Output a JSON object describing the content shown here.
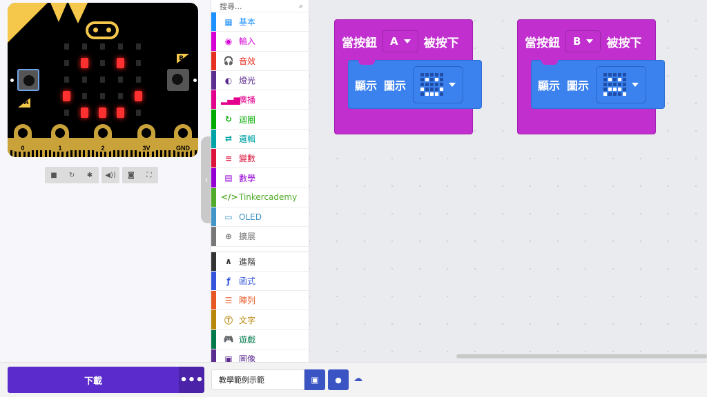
{
  "simulator": {
    "board": {
      "button_a_label": "A",
      "button_b_label": "B",
      "pins": [
        "0",
        "1",
        "2",
        "3V",
        "GND"
      ],
      "leds": [
        [
          0,
          0,
          0,
          0,
          0
        ],
        [
          0,
          1,
          0,
          1,
          0
        ],
        [
          0,
          0,
          0,
          0,
          0
        ],
        [
          1,
          0,
          0,
          0,
          1
        ],
        [
          0,
          1,
          1,
          1,
          0
        ]
      ]
    },
    "controls": [
      "stop-icon",
      "restart-icon",
      "debug-icon",
      "mute-icon",
      "screenshot-icon",
      "fullscreen-icon"
    ]
  },
  "toolbox": {
    "search_placeholder": "搜尋...",
    "categories": [
      {
        "label": "基本",
        "color": "#1e90ff",
        "icon": "grid-icon",
        "glyph": "▦"
      },
      {
        "label": "輸入",
        "color": "#d400d4",
        "icon": "target-icon",
        "glyph": "◉"
      },
      {
        "label": "音效",
        "color": "#e63022",
        "icon": "headphones-icon",
        "glyph": "🎧"
      },
      {
        "label": "燈光",
        "color": "#5c2d91",
        "icon": "toggle-icon",
        "glyph": "◐"
      },
      {
        "label": "廣播",
        "color": "#e3008c",
        "icon": "signal-icon",
        "glyph": "▂▄▆"
      },
      {
        "label": "迴圈",
        "color": "#00aa00",
        "icon": "loop-icon",
        "glyph": "↻"
      },
      {
        "label": "邏輯",
        "color": "#00a4a6",
        "icon": "shuffle-icon",
        "glyph": "⇄"
      },
      {
        "label": "變數",
        "color": "#dc143c",
        "icon": "list-icon",
        "glyph": "≡"
      },
      {
        "label": "數學",
        "color": "#9400d3",
        "icon": "calculator-icon",
        "glyph": "▤"
      },
      {
        "label": "Tinkercademy",
        "color": "#4fab29",
        "icon": "code-icon",
        "glyph": "</>"
      },
      {
        "label": "OLED",
        "color": "#4096c7",
        "icon": "monitor-icon",
        "glyph": "▭"
      },
      {
        "label": "擴展",
        "color": "#777777",
        "icon": "plus-circle-icon",
        "glyph": "⊕"
      }
    ],
    "advanced": [
      {
        "label": "進階",
        "color": "#333333",
        "icon": "chevron-up-icon",
        "glyph": "∧"
      },
      {
        "label": "函式",
        "color": "#3455db",
        "icon": "function-icon",
        "glyph": "ƒ"
      },
      {
        "label": "陣列",
        "color": "#e65722",
        "icon": "array-icon",
        "glyph": "☰"
      },
      {
        "label": "文字",
        "color": "#b8860b",
        "icon": "text-icon",
        "glyph": "Ⓣ"
      },
      {
        "label": "遊戲",
        "color": "#007a4b",
        "icon": "gamepad-icon",
        "glyph": "🎮"
      },
      {
        "label": "圖像",
        "color": "#5c2d91",
        "icon": "image-icon",
        "glyph": "▣"
      }
    ]
  },
  "workspace": {
    "blocks": [
      {
        "event_prefix": "當按鈕",
        "button": "A",
        "event_suffix": "被按下",
        "show_label": "顯示",
        "image_label": "圖示",
        "image": [
          [
            0,
            0,
            0,
            0,
            0
          ],
          [
            0,
            1,
            0,
            1,
            0
          ],
          [
            0,
            0,
            0,
            0,
            0
          ],
          [
            1,
            0,
            0,
            0,
            1
          ],
          [
            0,
            1,
            1,
            1,
            0
          ]
        ]
      },
      {
        "event_prefix": "當按鈕",
        "button": "B",
        "event_suffix": "被按下",
        "show_label": "顯示",
        "image_label": "圖示",
        "image": [
          [
            0,
            0,
            0,
            0,
            0
          ],
          [
            0,
            1,
            0,
            1,
            0
          ],
          [
            0,
            0,
            0,
            0,
            0
          ],
          [
            0,
            1,
            1,
            1,
            0
          ],
          [
            1,
            0,
            0,
            0,
            1
          ]
        ]
      }
    ]
  },
  "bottom_bar": {
    "download_label": "下載",
    "more_label": "•••",
    "project_name": "教學範例示範"
  },
  "colors": {
    "event_block": "#c22fcf",
    "basic_block": "#3c82ee",
    "download": "#5b2ccb"
  }
}
